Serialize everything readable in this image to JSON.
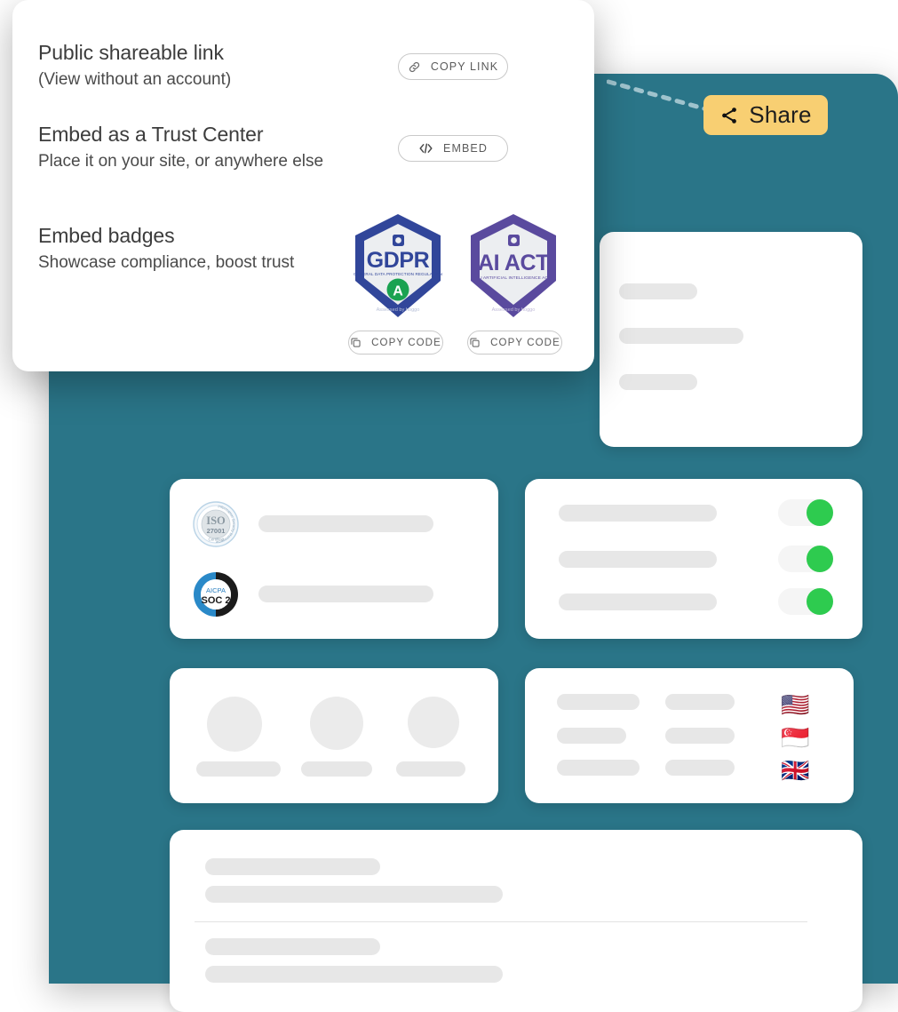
{
  "share_button": {
    "label": "Share",
    "icon": "share-icon",
    "bg": "#f8cf72"
  },
  "panel": {
    "rows": [
      {
        "title": "Public shareable link",
        "subtitle": "(View without an account)",
        "action_label": "COPY LINK",
        "action_icon": "link-icon"
      },
      {
        "title": "Embed as a Trust Center",
        "subtitle": "Place it on your site, or anywhere else",
        "action_label": "EMBED",
        "action_icon": "code-icon"
      },
      {
        "title": "Embed badges",
        "subtitle": "Showcase compliance, boost trust",
        "action_label": "",
        "action_icon": ""
      }
    ],
    "badges": [
      {
        "name": "GDPR",
        "subtitle": "GENERAL DATA PROTECTION REGULATION",
        "grade": "A",
        "footer": "Assessed by hoggo",
        "color": "#31469a",
        "grade_color": "#1aa251",
        "copy_label": "COPY CODE",
        "copy_icon": "copy-icon"
      },
      {
        "name": "AI ACT",
        "subtitle": "EU ARTIFICIAL INTELLIGENCE ACT",
        "grade": "",
        "footer": "Assessed by hoggo",
        "color": "#5a4a9e",
        "grade_color": "",
        "copy_label": "COPY CODE",
        "copy_icon": "copy-icon"
      }
    ]
  },
  "dashboard": {
    "bg": "#2a7588",
    "cards": {
      "top": {
        "name": "skeleton-card-top",
        "bars": 3
      },
      "iso": {
        "name": "certifications-card",
        "badges": [
          "ISO 27001",
          "AICPA SOC 2"
        ]
      },
      "toggles": {
        "name": "toggles-card",
        "toggle_count": 3,
        "toggle_state": "on",
        "toggle_color": "#2ecb4f"
      },
      "avatars": {
        "name": "team-avatars-card",
        "avatar_count": 3
      },
      "flags": {
        "name": "regions-card",
        "flags": [
          "🇺🇸",
          "🇸🇬",
          "🇬🇧"
        ]
      },
      "bottom": {
        "name": "skeleton-card-bottom",
        "bar_groups": 2
      }
    }
  },
  "iso_badge": {
    "top_text": "ISO",
    "number": "27001",
    "ring_text": "Certified"
  },
  "soc_badge": {
    "top_text": "AICPA",
    "main_text": "SOC 2"
  }
}
